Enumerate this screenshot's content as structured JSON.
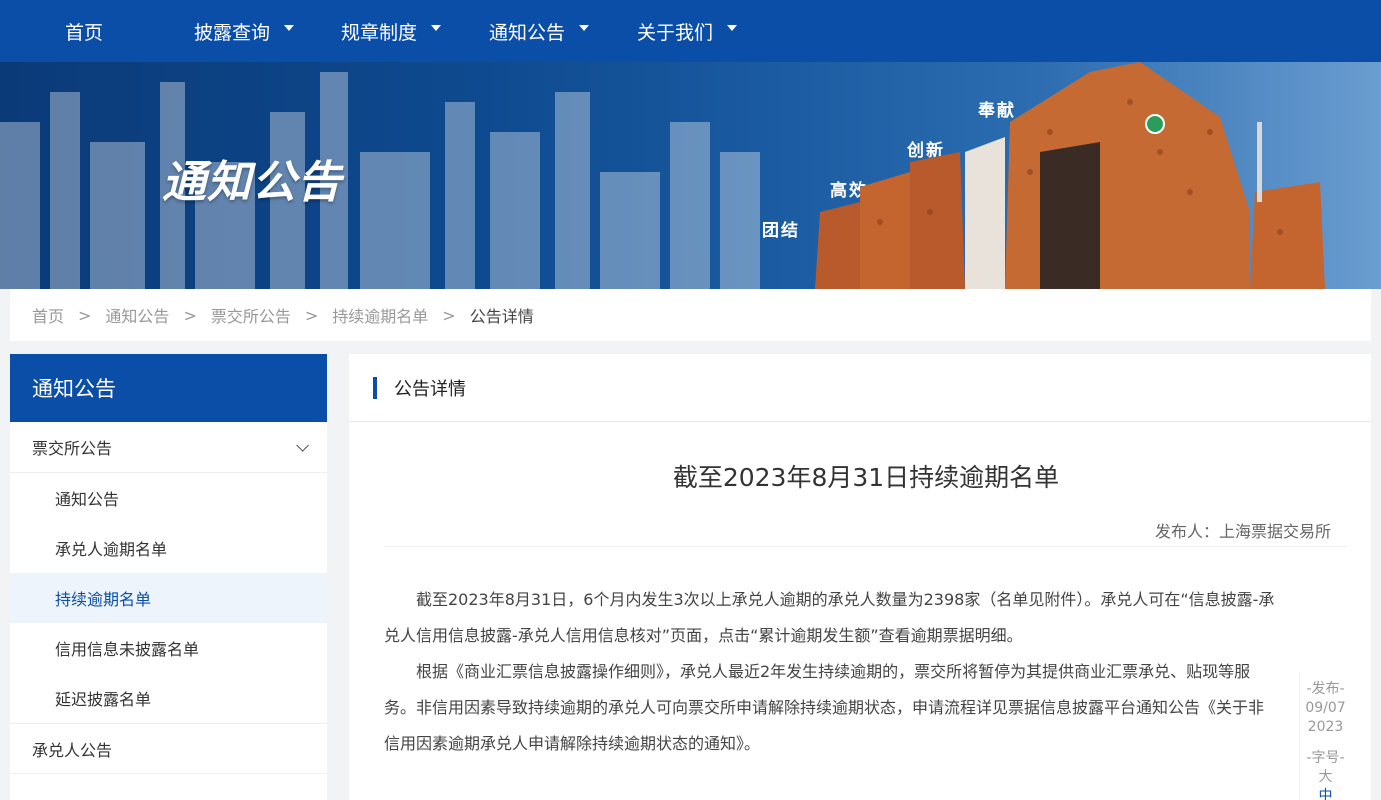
{
  "nav": {
    "items": [
      {
        "label": "首页",
        "dropdown": false
      },
      {
        "label": "披露查询",
        "dropdown": true
      },
      {
        "label": "规章制度",
        "dropdown": true
      },
      {
        "label": "通知公告",
        "dropdown": true
      },
      {
        "label": "关于我们",
        "dropdown": true
      }
    ]
  },
  "banner": {
    "title": "通知公告",
    "slogans": [
      "团结",
      "高效",
      "创新",
      "奉献"
    ]
  },
  "breadcrumb": [
    "首页",
    "通知公告",
    "票交所公告",
    "持续逾期名单",
    "公告详情"
  ],
  "sidebar": {
    "title": "通知公告",
    "group1": "票交所公告",
    "subitems": [
      "通知公告",
      "承兑人逾期名单",
      "持续逾期名单",
      "信用信息未披露名单",
      "延迟披露名单"
    ],
    "active_index": 2,
    "group2": "承兑人公告"
  },
  "main": {
    "section_title": "公告详情",
    "article_title": "截至2023年8月31日持续逾期名单",
    "publisher": "发布人：上海票据交易所",
    "paragraphs": [
      "截至2023年8月31日，6个月内发生3次以上承兑人逾期的承兑人数量为2398家（名单见附件）。承兑人可在“信息披露-承兑人信用信息披露-承兑人信用信息核对”页面，点击“累计逾期发生额”查看逾期票据明细。",
      "根据《商业汇票信息披露操作细则》，承兑人最近2年发生持续逾期的，票交所将暂停为其提供商业汇票承兑、贴现等服务。非信用因素导致持续逾期的承兑人可向票交所申请解除持续逾期状态，申请流程详见票据信息披露平台通知公告《关于非信用因素逾期承兑人申请解除持续逾期状态的通知》。"
    ],
    "tools": {
      "publish_label": "-发布-",
      "publish_date_1": "09/07",
      "publish_date_2": "2023",
      "font_label": "-字号-",
      "font_large": "大",
      "font_medium": "中"
    }
  },
  "colors": {
    "primary": "#0a4ea8",
    "active_bg": "#eef4fb"
  }
}
